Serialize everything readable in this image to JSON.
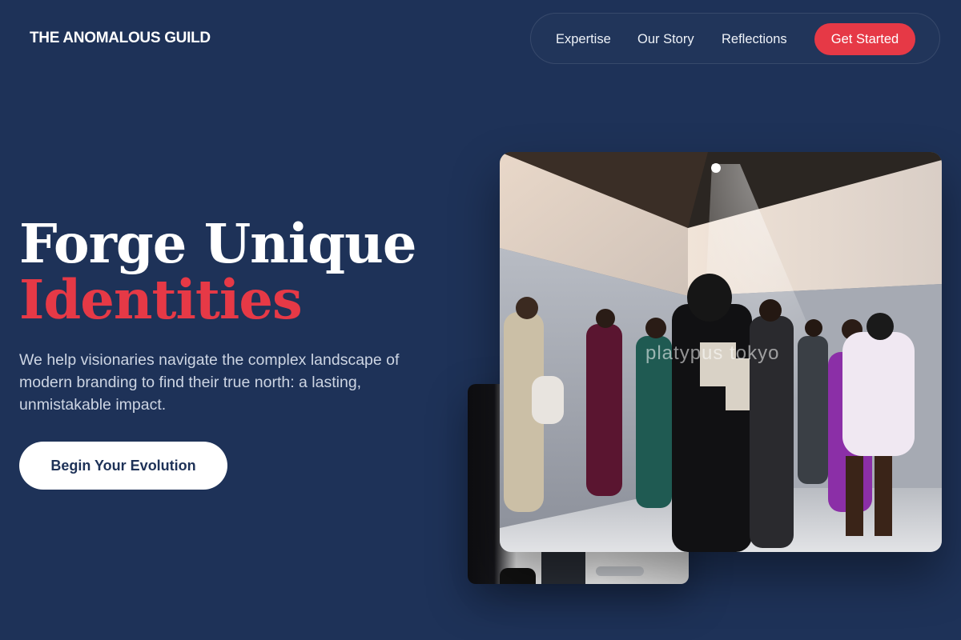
{
  "brand": {
    "name": "THE ANOMALOUS GUILD"
  },
  "nav": {
    "links": [
      "Expertise",
      "Our Story",
      "Reflections"
    ],
    "cta_label": "Get Started"
  },
  "hero": {
    "title_line1": "Forge Unique",
    "title_line2": "Identities",
    "subtitle": "We help visionaries navigate the complex landscape of modern branding to find their true north: a lasting, unmistakable impact.",
    "button_label": "Begin Your Evolution"
  },
  "images": {
    "main_icon": "fashion-show-photo",
    "back_icon": "studio-photo",
    "watermark": "platypus tokyo"
  },
  "colors": {
    "background": "#1e3258",
    "accent": "#e63946",
    "text": "#ffffff"
  }
}
